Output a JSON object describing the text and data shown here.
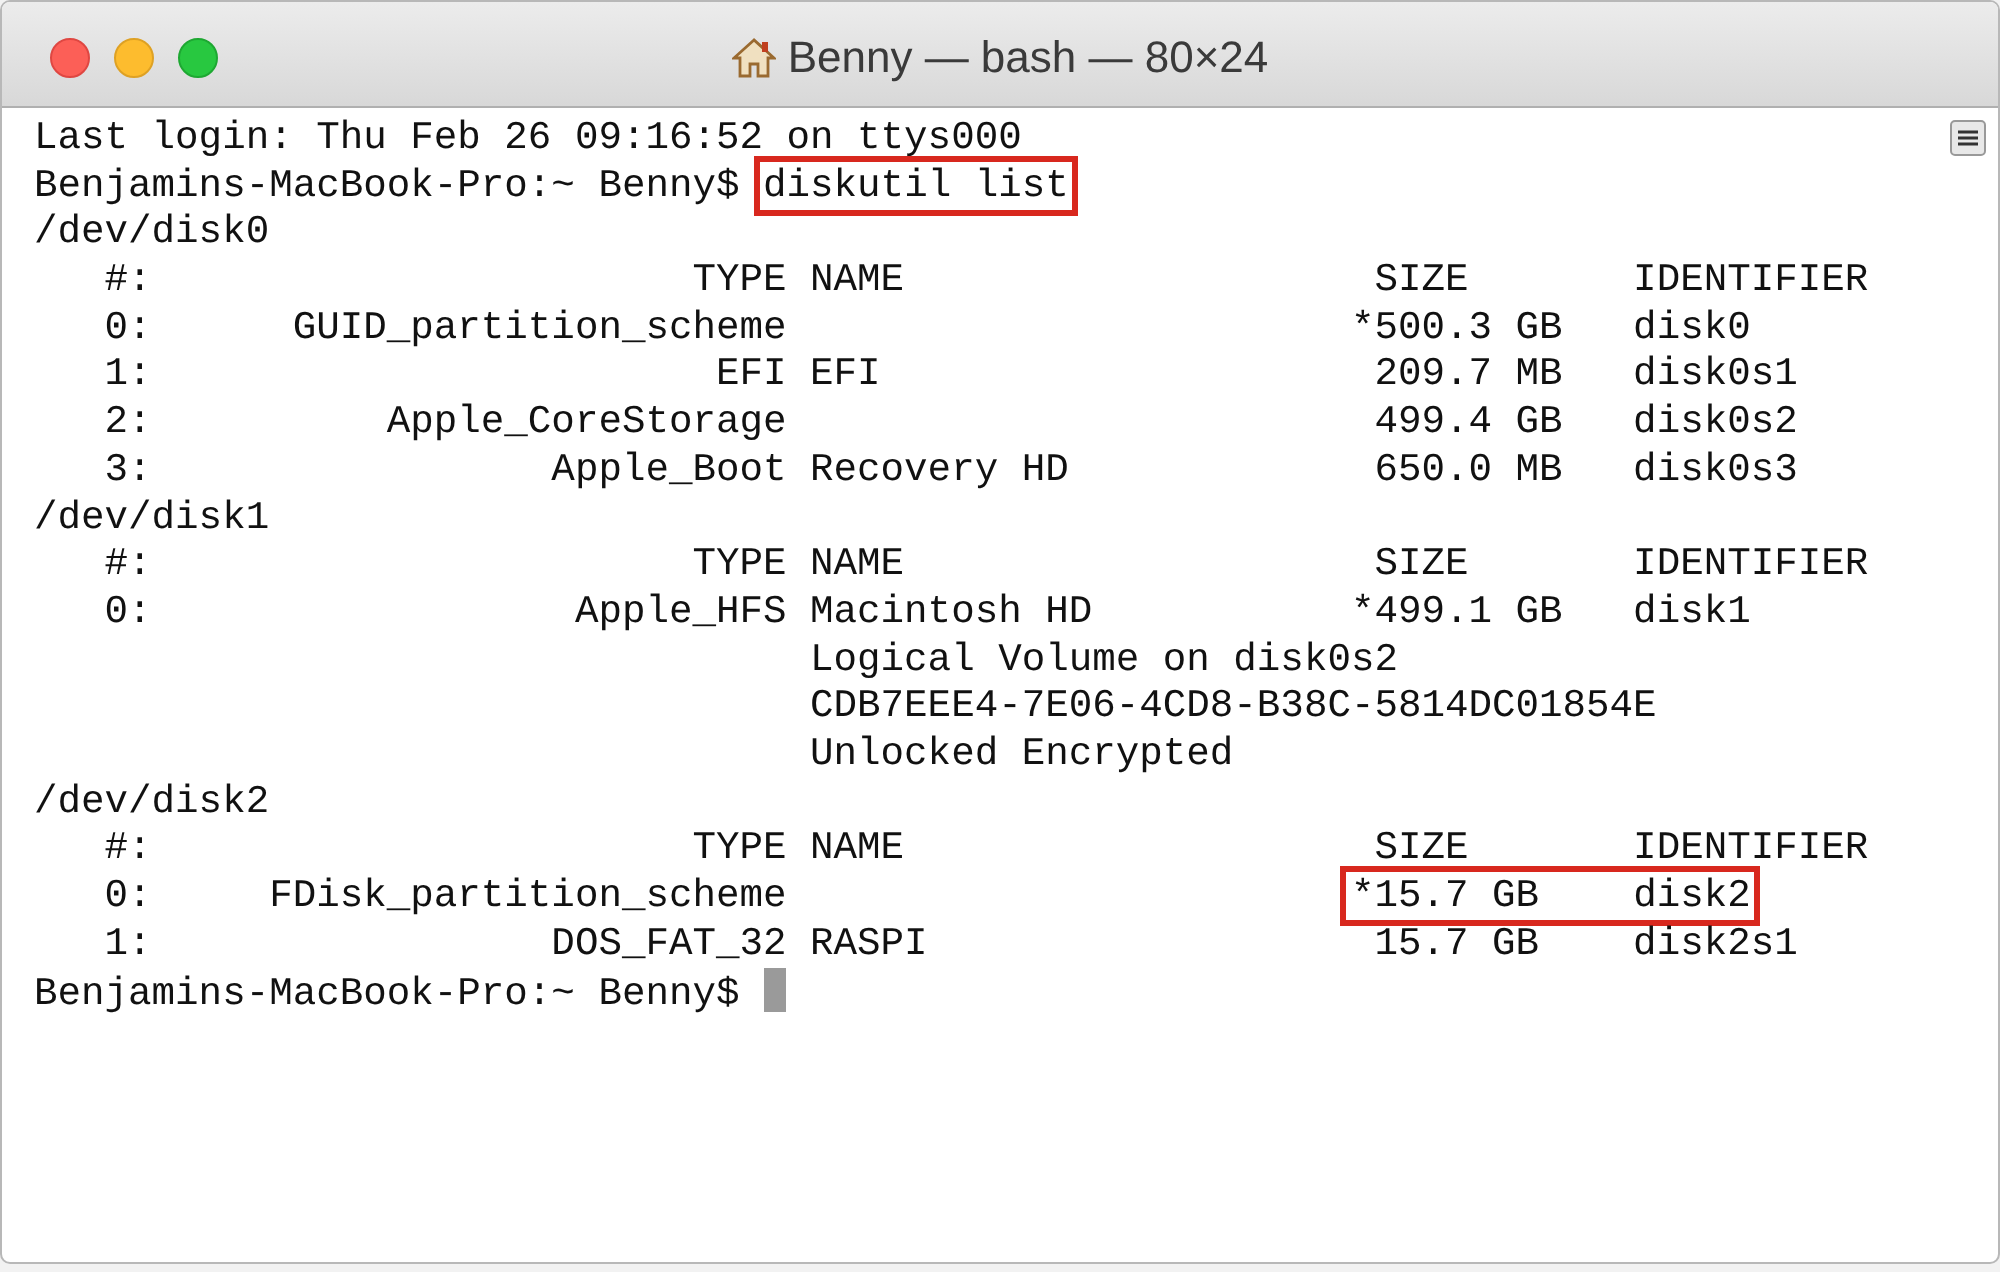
{
  "window": {
    "title": "Benny — bash — 80×24"
  },
  "terminal": {
    "lines": [
      [
        {
          "text": "Last login: Thu Feb 26 09:16:52 on ttys000",
          "boxed": false
        }
      ],
      [
        {
          "text": "Benjamins-MacBook-Pro:~ Benny$ ",
          "boxed": false
        },
        {
          "text": "diskutil list",
          "boxed": true
        }
      ],
      [
        {
          "text": "/dev/disk0",
          "boxed": false
        }
      ],
      [
        {
          "text": "   #:                       TYPE NAME                    SIZE       IDENTIFIER",
          "boxed": false
        }
      ],
      [
        {
          "text": "   0:      GUID_partition_scheme                        *500.3 GB   disk0",
          "boxed": false
        }
      ],
      [
        {
          "text": "   1:                        EFI EFI                     209.7 MB   disk0s1",
          "boxed": false
        }
      ],
      [
        {
          "text": "   2:          Apple_CoreStorage                         499.4 GB   disk0s2",
          "boxed": false
        }
      ],
      [
        {
          "text": "   3:                 Apple_Boot Recovery HD             650.0 MB   disk0s3",
          "boxed": false
        }
      ],
      [
        {
          "text": "/dev/disk1",
          "boxed": false
        }
      ],
      [
        {
          "text": "   #:                       TYPE NAME                    SIZE       IDENTIFIER",
          "boxed": false
        }
      ],
      [
        {
          "text": "   0:                  Apple_HFS Macintosh HD           *499.1 GB   disk1",
          "boxed": false
        }
      ],
      [
        {
          "text": "                                 Logical Volume on disk0s2",
          "boxed": false
        }
      ],
      [
        {
          "text": "                                 CDB7EEE4-7E06-4CD8-B38C-5814DC01854E",
          "boxed": false
        }
      ],
      [
        {
          "text": "                                 Unlocked Encrypted",
          "boxed": false
        }
      ],
      [
        {
          "text": "/dev/disk2",
          "boxed": false
        }
      ],
      [
        {
          "text": "   #:                       TYPE NAME                    SIZE       IDENTIFIER",
          "boxed": false
        }
      ],
      [
        {
          "text": "   0:     FDisk_partition_scheme                        ",
          "boxed": false
        },
        {
          "text": "*15.7 GB    disk2",
          "boxed": true
        }
      ],
      [
        {
          "text": "   1:                 DOS_FAT_32 RASPI                   15.7 GB    disk2s1",
          "boxed": false
        }
      ],
      [
        {
          "text": "Benjamins-MacBook-Pro:~ Benny$ ",
          "boxed": false
        }
      ]
    ],
    "cursor_visible": true
  }
}
